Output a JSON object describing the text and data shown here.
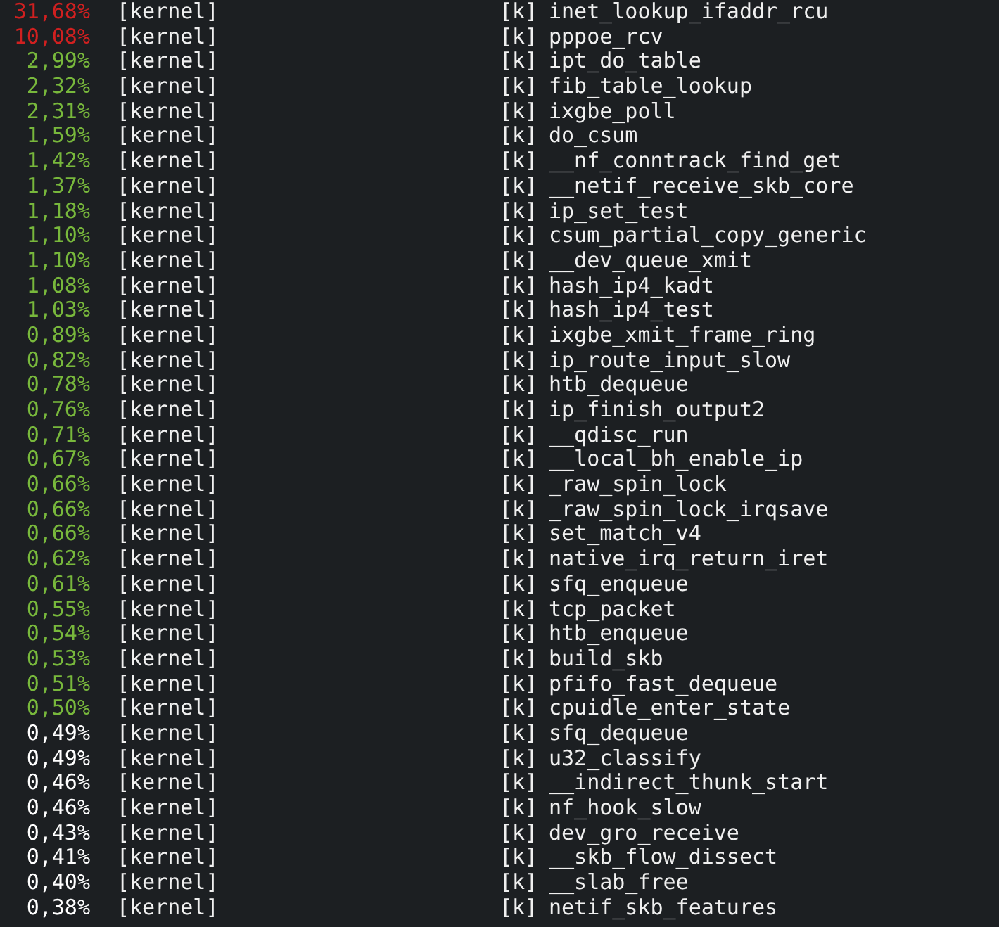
{
  "rows": [
    {
      "overhead": "31,68%",
      "color": "#d02020",
      "dso": "[kernel]",
      "type": "[k]",
      "symbol": "inet_lookup_ifaddr_rcu"
    },
    {
      "overhead": "10,08%",
      "color": "#d02020",
      "dso": "[kernel]",
      "type": "[k]",
      "symbol": "pppoe_rcv"
    },
    {
      "overhead": "2,99%",
      "color": "#78b83c",
      "dso": "[kernel]",
      "type": "[k]",
      "symbol": "ipt_do_table"
    },
    {
      "overhead": "2,32%",
      "color": "#78b83c",
      "dso": "[kernel]",
      "type": "[k]",
      "symbol": "fib_table_lookup"
    },
    {
      "overhead": "2,31%",
      "color": "#78b83c",
      "dso": "[kernel]",
      "type": "[k]",
      "symbol": "ixgbe_poll"
    },
    {
      "overhead": "1,59%",
      "color": "#78b83c",
      "dso": "[kernel]",
      "type": "[k]",
      "symbol": "do_csum"
    },
    {
      "overhead": "1,42%",
      "color": "#78b83c",
      "dso": "[kernel]",
      "type": "[k]",
      "symbol": "__nf_conntrack_find_get"
    },
    {
      "overhead": "1,37%",
      "color": "#78b83c",
      "dso": "[kernel]",
      "type": "[k]",
      "symbol": "__netif_receive_skb_core"
    },
    {
      "overhead": "1,18%",
      "color": "#78b83c",
      "dso": "[kernel]",
      "type": "[k]",
      "symbol": "ip_set_test"
    },
    {
      "overhead": "1,10%",
      "color": "#78b83c",
      "dso": "[kernel]",
      "type": "[k]",
      "symbol": "csum_partial_copy_generic"
    },
    {
      "overhead": "1,10%",
      "color": "#78b83c",
      "dso": "[kernel]",
      "type": "[k]",
      "symbol": "__dev_queue_xmit"
    },
    {
      "overhead": "1,08%",
      "color": "#78b83c",
      "dso": "[kernel]",
      "type": "[k]",
      "symbol": "hash_ip4_kadt"
    },
    {
      "overhead": "1,03%",
      "color": "#78b83c",
      "dso": "[kernel]",
      "type": "[k]",
      "symbol": "hash_ip4_test"
    },
    {
      "overhead": "0,89%",
      "color": "#78b83c",
      "dso": "[kernel]",
      "type": "[k]",
      "symbol": "ixgbe_xmit_frame_ring"
    },
    {
      "overhead": "0,82%",
      "color": "#78b83c",
      "dso": "[kernel]",
      "type": "[k]",
      "symbol": "ip_route_input_slow"
    },
    {
      "overhead": "0,78%",
      "color": "#78b83c",
      "dso": "[kernel]",
      "type": "[k]",
      "symbol": "htb_dequeue"
    },
    {
      "overhead": "0,76%",
      "color": "#78b83c",
      "dso": "[kernel]",
      "type": "[k]",
      "symbol": "ip_finish_output2"
    },
    {
      "overhead": "0,71%",
      "color": "#78b83c",
      "dso": "[kernel]",
      "type": "[k]",
      "symbol": "__qdisc_run"
    },
    {
      "overhead": "0,67%",
      "color": "#78b83c",
      "dso": "[kernel]",
      "type": "[k]",
      "symbol": "__local_bh_enable_ip"
    },
    {
      "overhead": "0,66%",
      "color": "#78b83c",
      "dso": "[kernel]",
      "type": "[k]",
      "symbol": "_raw_spin_lock"
    },
    {
      "overhead": "0,66%",
      "color": "#78b83c",
      "dso": "[kernel]",
      "type": "[k]",
      "symbol": "_raw_spin_lock_irqsave"
    },
    {
      "overhead": "0,66%",
      "color": "#78b83c",
      "dso": "[kernel]",
      "type": "[k]",
      "symbol": "set_match_v4"
    },
    {
      "overhead": "0,62%",
      "color": "#78b83c",
      "dso": "[kernel]",
      "type": "[k]",
      "symbol": "native_irq_return_iret"
    },
    {
      "overhead": "0,61%",
      "color": "#78b83c",
      "dso": "[kernel]",
      "type": "[k]",
      "symbol": "sfq_enqueue"
    },
    {
      "overhead": "0,55%",
      "color": "#78b83c",
      "dso": "[kernel]",
      "type": "[k]",
      "symbol": "tcp_packet"
    },
    {
      "overhead": "0,54%",
      "color": "#78b83c",
      "dso": "[kernel]",
      "type": "[k]",
      "symbol": "htb_enqueue"
    },
    {
      "overhead": "0,53%",
      "color": "#78b83c",
      "dso": "[kernel]",
      "type": "[k]",
      "symbol": "build_skb"
    },
    {
      "overhead": "0,51%",
      "color": "#78b83c",
      "dso": "[kernel]",
      "type": "[k]",
      "symbol": "pfifo_fast_dequeue"
    },
    {
      "overhead": "0,50%",
      "color": "#78b83c",
      "dso": "[kernel]",
      "type": "[k]",
      "symbol": "cpuidle_enter_state"
    },
    {
      "overhead": "0,49%",
      "color": "#ffffff",
      "dso": "[kernel]",
      "type": "[k]",
      "symbol": "sfq_dequeue"
    },
    {
      "overhead": "0,49%",
      "color": "#ffffff",
      "dso": "[kernel]",
      "type": "[k]",
      "symbol": "u32_classify"
    },
    {
      "overhead": "0,46%",
      "color": "#ffffff",
      "dso": "[kernel]",
      "type": "[k]",
      "symbol": "__indirect_thunk_start"
    },
    {
      "overhead": "0,46%",
      "color": "#ffffff",
      "dso": "[kernel]",
      "type": "[k]",
      "symbol": "nf_hook_slow"
    },
    {
      "overhead": "0,43%",
      "color": "#ffffff",
      "dso": "[kernel]",
      "type": "[k]",
      "symbol": "dev_gro_receive"
    },
    {
      "overhead": "0,41%",
      "color": "#ffffff",
      "dso": "[kernel]",
      "type": "[k]",
      "symbol": "__skb_flow_dissect"
    },
    {
      "overhead": "0,40%",
      "color": "#ffffff",
      "dso": "[kernel]",
      "type": "[k]",
      "symbol": "__slab_free"
    },
    {
      "overhead": "0,38%",
      "color": "#ffffff",
      "dso": "[kernel]",
      "type": "[k]",
      "symbol": "netif_skb_features"
    }
  ]
}
